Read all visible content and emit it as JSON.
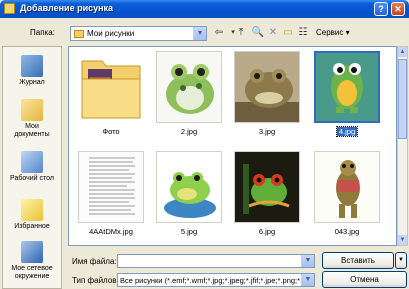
{
  "window": {
    "title": "Добавление рисунка",
    "help_label": "?",
    "close_label": "✕"
  },
  "toolbar": {
    "look_in_label": "Папка:",
    "look_in_value": "Мои рисунки",
    "tools_label": "Сервис ▾"
  },
  "places": [
    {
      "label": "Журнал",
      "icon": "history-icon"
    },
    {
      "label": "Мои документы",
      "icon": "my-documents-icon"
    },
    {
      "label": "Рабочий стол",
      "icon": "desktop-icon"
    },
    {
      "label": "Избранное",
      "icon": "favorites-icon"
    },
    {
      "label": "Мое сетевое окружение",
      "icon": "network-icon"
    }
  ],
  "files": [
    {
      "name": "Фото",
      "kind": "folder"
    },
    {
      "name": "2.jpg",
      "kind": "frog-white"
    },
    {
      "name": "3.jpg",
      "kind": "frog-brown"
    },
    {
      "name": "4.jpg",
      "kind": "frog-cartoon",
      "selected": true
    },
    {
      "name": "4AAtDMx.jpg",
      "kind": "text-doc"
    },
    {
      "name": "5.jpg",
      "kind": "frog-lilypad"
    },
    {
      "name": "6.jpg",
      "kind": "frog-tree"
    },
    {
      "name": "043.jpg",
      "kind": "frog-standing"
    }
  ],
  "filename_label": "Имя файла:",
  "filename_value": "",
  "filetype_label": "Тип файлов:",
  "filetype_value": "Все рисунки (*.emf;*.wmf;*.jpg;*.jpeg;*.jfif;*.jpe;*.png;*",
  "insert_label": "Вставить",
  "cancel_label": "Отмена"
}
